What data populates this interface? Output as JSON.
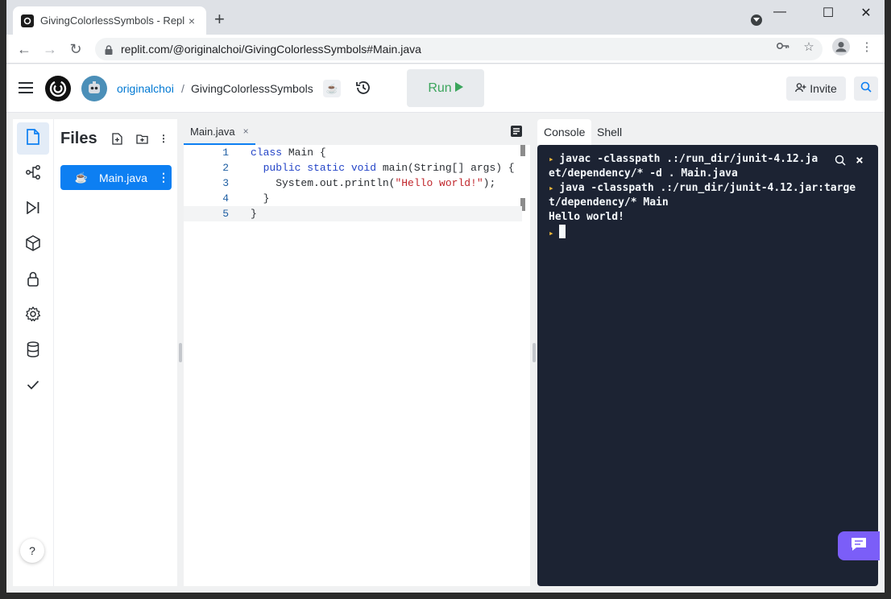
{
  "browser": {
    "tab_title": "GivingColorlessSymbols - Replit",
    "tab_close": "×",
    "new_tab": "+",
    "url": "replit.com/@originalchoi/GivingColorlessSymbols#Main.java",
    "window_controls": [
      "—",
      "☐",
      "✕"
    ]
  },
  "header": {
    "username": "originalchoi",
    "separator": "/",
    "repl_name": "GivingColorlessSymbols",
    "lang_badge": "☕",
    "run_label": "Run",
    "invite_label": "Invite"
  },
  "files": {
    "title": "Files",
    "items": [
      {
        "name": "Main.java",
        "icon": "java-icon"
      }
    ]
  },
  "editor": {
    "tab": "Main.java",
    "tab_close": "×",
    "lines": [
      {
        "n": "1",
        "parts": [
          [
            "kw",
            "class"
          ],
          [
            "",
            "Main {"
          ]
        ]
      },
      {
        "n": "2",
        "parts": [
          [
            "",
            "  "
          ],
          [
            "kw",
            "public static void"
          ],
          [
            "",
            " main(String[] args) {"
          ]
        ]
      },
      {
        "n": "3",
        "parts": [
          [
            "",
            "    System.out.println("
          ],
          [
            "str",
            "\"Hello world!\""
          ],
          [
            "",
            ");"
          ]
        ]
      },
      {
        "n": "4",
        "parts": [
          [
            "",
            "  }"
          ]
        ]
      },
      {
        "n": "5",
        "parts": [
          [
            "",
            "}"
          ]
        ]
      }
    ]
  },
  "console": {
    "tabs": [
      "Console",
      "Shell"
    ],
    "lines": [
      {
        "prompt": true,
        "text": "javac -classpath .:/run_dir/junit-4.12.ja"
      },
      {
        "prompt": false,
        "text": "et/dependency/* -d . Main.java"
      },
      {
        "prompt": true,
        "text": "java -classpath .:/run_dir/junit-4.12.jar:targe"
      },
      {
        "prompt": false,
        "text": "t/dependency/* Main"
      },
      {
        "prompt": false,
        "text": "Hello world!"
      },
      {
        "prompt": true,
        "text": "",
        "cursor": true
      }
    ],
    "close": "×"
  },
  "help": "?",
  "colors": {
    "accent": "#0d7ff2",
    "run_green": "#3ba55c",
    "console_bg": "#1c2333",
    "prompt": "#f0b93a",
    "chat": "#7b5ef8"
  }
}
